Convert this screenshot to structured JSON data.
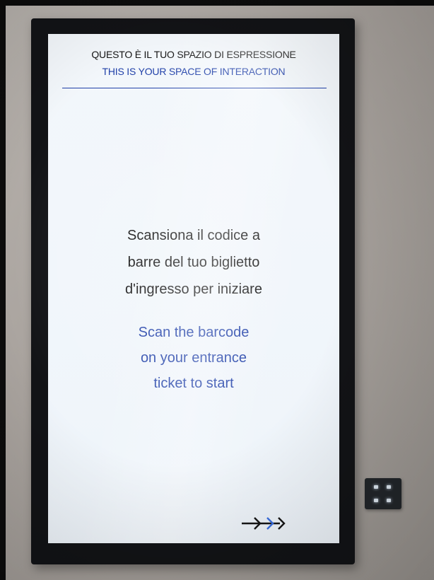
{
  "header": {
    "title_it": "QUESTO È IL TUO SPAZIO DI ESPRESSIONE",
    "title_en": "THIS IS YOUR SPACE OF INTERACTION"
  },
  "main": {
    "instruction_it": [
      "Scansiona il codice a",
      "barre del tuo biglietto",
      "d'ingresso per iniziare"
    ],
    "instruction_en": [
      "Scan the barcode",
      "on your entrance",
      "ticket to start"
    ]
  },
  "icons": {
    "next": "triple-arrow-right-icon",
    "scanner": "barcode-scanner-icon"
  },
  "colors": {
    "screen_background": "#f1f6fb",
    "primary_text": "#151515",
    "accent_blue": "#1f3fa8",
    "arrow_accent": "#3b6fe0",
    "monitor_bezel": "#121316"
  }
}
